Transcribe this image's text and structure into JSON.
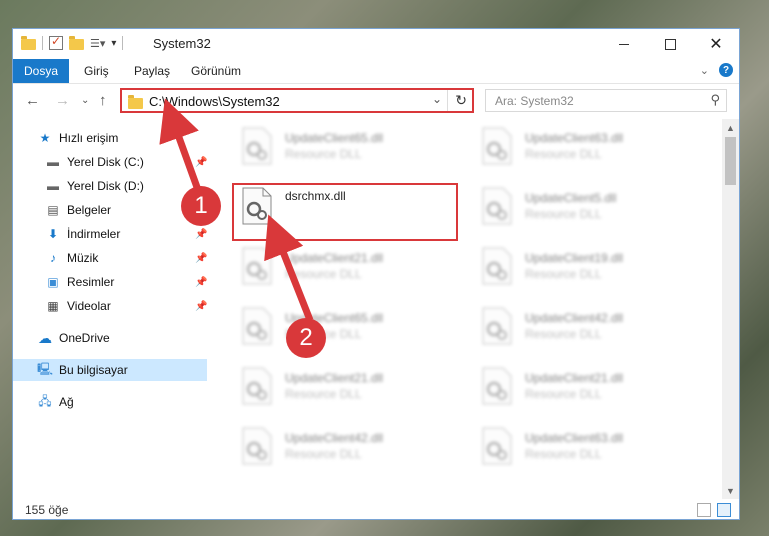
{
  "window": {
    "title": "System32"
  },
  "ribbon": {
    "tabs": [
      "Dosya",
      "Giriş",
      "Paylaş",
      "Görünüm"
    ]
  },
  "address": {
    "path": "C:\\Windows\\System32"
  },
  "search": {
    "placeholder": "Ara: System32"
  },
  "sidebar": {
    "items": [
      {
        "label": "Hızlı erişim",
        "icon": "star-icon"
      },
      {
        "label": "Yerel Disk (C:)",
        "icon": "drive-icon",
        "pinned": true
      },
      {
        "label": "Yerel Disk (D:)",
        "icon": "drive-icon"
      },
      {
        "label": "Belgeler",
        "icon": "documents-icon",
        "pinned": true
      },
      {
        "label": "İndirmeler",
        "icon": "download-icon",
        "pinned": true
      },
      {
        "label": "Müzik",
        "icon": "music-icon",
        "pinned": true
      },
      {
        "label": "Resimler",
        "icon": "pictures-icon",
        "pinned": true
      },
      {
        "label": "Videolar",
        "icon": "videos-icon",
        "pinned": true
      },
      {
        "label": "OneDrive",
        "icon": "cloud-icon"
      },
      {
        "label": "Bu bilgisayar",
        "icon": "computer-icon",
        "selected": true
      },
      {
        "label": "Ağ",
        "icon": "network-icon"
      }
    ]
  },
  "files": [
    {
      "name": "UpdateClient65.dll",
      "type": "Resource DLL"
    },
    {
      "name": "UpdateClient63.dll",
      "type": "Resource DLL"
    },
    {
      "name": "dsrchmx.dll",
      "type": ""
    },
    {
      "name": "UpdateClient5.dll",
      "type": "Resource DLL"
    },
    {
      "name": "UpdateClient21.dll",
      "type": "Resource DLL"
    },
    {
      "name": "UpdateClient19.dll",
      "type": "Resource DLL"
    },
    {
      "name": "UpdateClient65.dll",
      "type": "Resource DLL"
    },
    {
      "name": "UpdateClient42.dll",
      "type": "Resource DLL"
    },
    {
      "name": "UpdateClient21.dll",
      "type": "Resource DLL"
    },
    {
      "name": "UpdateClient21.dll",
      "type": "Resource DLL"
    },
    {
      "name": "UpdateClient42.dll",
      "type": "Resource DLL"
    },
    {
      "name": "UpdateClient63.dll",
      "type": "Resource DLL"
    }
  ],
  "status": {
    "count": "155 öğe"
  },
  "annotations": {
    "step1": "1",
    "step2": "2"
  },
  "colors": {
    "accent": "#1979ca",
    "highlight": "#d9383a",
    "selection": "#cce8ff"
  }
}
